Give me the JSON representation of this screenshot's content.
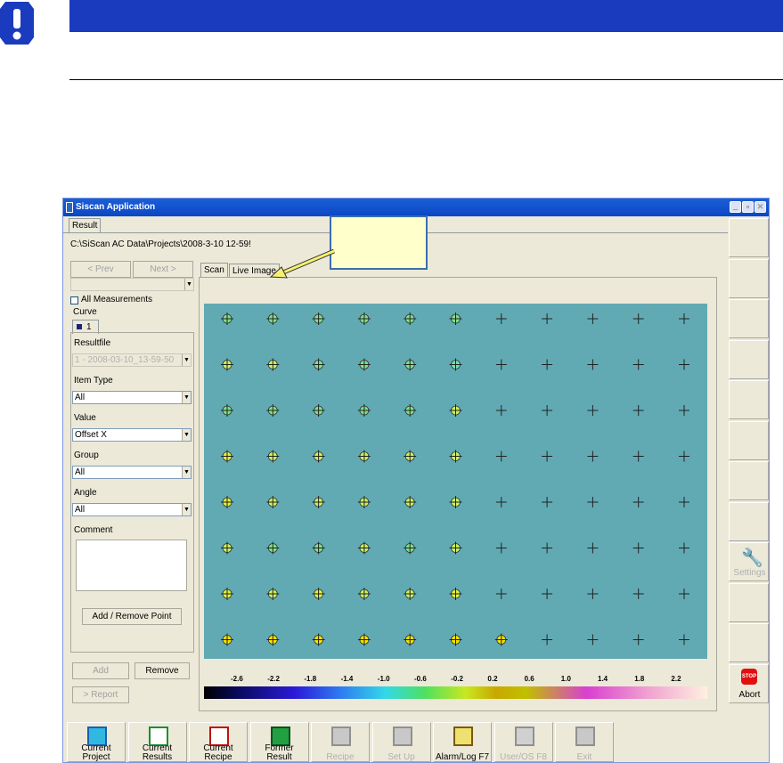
{
  "window": {
    "title": "Siscan Application",
    "tab": "Result",
    "path": "C:\\SiScan AC Data\\Projects\\2008-3-10 12-59!"
  },
  "left_panel": {
    "prev_label": "< Prev",
    "next_label": "Next >",
    "all_measurements_label": "All Measurements",
    "curve_label": "Curve",
    "curve_tab": "1",
    "resultfile_label": "Resultfile",
    "resultfile_value": "1 - 2008-03-10_13-59-50",
    "item_type_label": "Item Type",
    "item_type_value": "All",
    "value_label": "Value",
    "value_value": "Offset X",
    "group_label": "Group",
    "group_value": "All",
    "angle_label": "Angle",
    "angle_value": "All",
    "comment_label": "Comment",
    "add_remove_point_label": "Add / Remove Point",
    "add_label": "Add",
    "remove_label": "Remove",
    "report_label": "> Report"
  },
  "main": {
    "tabs": [
      "Scan",
      "Live Image"
    ],
    "colorbar_ticks": [
      "-2.6",
      "-2.2",
      "-1.8",
      "-1.4",
      "-1.0",
      "-0.6",
      "-0.2",
      "0.2",
      "0.6",
      "1.0",
      "1.4",
      "1.8",
      "2.2"
    ],
    "grid_rows": [
      [
        "g",
        "g",
        "g",
        "g",
        "g",
        "g",
        "x",
        "x",
        "x",
        "x",
        "x"
      ],
      [
        "l",
        "l",
        "g",
        "g",
        "g",
        "c",
        "x",
        "x",
        "x",
        "x",
        "x"
      ],
      [
        "g",
        "g",
        "g",
        "g",
        "g",
        "l",
        "x",
        "x",
        "x",
        "x",
        "x"
      ],
      [
        "y",
        "l",
        "l",
        "l",
        "l",
        "l",
        "x",
        "x",
        "x",
        "x",
        "x"
      ],
      [
        "y",
        "l",
        "l",
        "l",
        "l",
        "l",
        "x",
        "x",
        "x",
        "x",
        "x"
      ],
      [
        "l",
        "g",
        "g",
        "l",
        "g",
        "l",
        "x",
        "x",
        "x",
        "x",
        "x"
      ],
      [
        "y",
        "l",
        "y",
        "l",
        "l",
        "y",
        "x",
        "x",
        "x",
        "x",
        "x"
      ],
      [
        "Y",
        "Y",
        "Y",
        "Y",
        "Y",
        "Y",
        "Y",
        "x",
        "x",
        "x",
        "x"
      ]
    ],
    "marker_colors": {
      "g": "#7fe08a",
      "c": "#6fe0b0",
      "l": "#c8f060",
      "y": "#e0f040",
      "Y": "#f5e000"
    }
  },
  "right_buttons": [
    "",
    "",
    "",
    "",
    "",
    "",
    "",
    "",
    "Settings",
    "",
    "",
    "Abort"
  ],
  "stop_badge": "STOP",
  "bottom_buttons": [
    {
      "line1": "Current",
      "line2": "Project",
      "enabled": true,
      "icon": "current-project-icon"
    },
    {
      "line1": "Current",
      "line2": "Results",
      "enabled": true,
      "icon": "current-results-icon"
    },
    {
      "line1": "Current",
      "line2": "Recipe",
      "enabled": true,
      "icon": "current-recipe-icon"
    },
    {
      "line1": "Former",
      "line2": "Result",
      "enabled": true,
      "icon": "former-result-icon"
    },
    {
      "line1": "",
      "line2": "Recipe",
      "enabled": false,
      "icon": "recipe-icon"
    },
    {
      "line1": "",
      "line2": "Set Up",
      "enabled": false,
      "icon": "setup-icon"
    },
    {
      "line1": "",
      "line2": "Alarm/Log F7",
      "enabled": true,
      "icon": "alarm-log-icon"
    },
    {
      "line1": "",
      "line2": "User/OS F8",
      "enabled": false,
      "icon": "user-os-icon"
    },
    {
      "line1": "",
      "line2": "Exit",
      "enabled": false,
      "icon": "exit-icon"
    }
  ]
}
